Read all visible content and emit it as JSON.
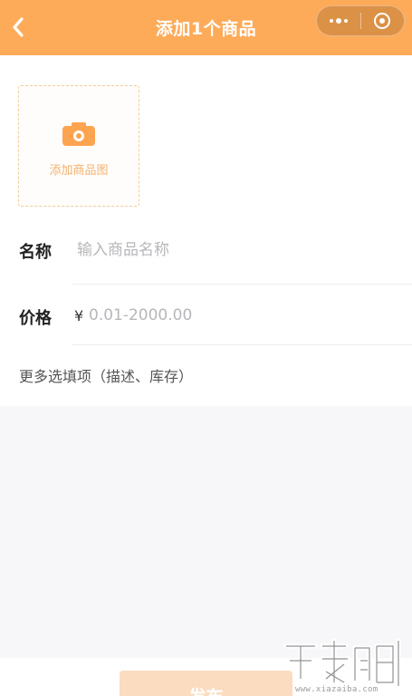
{
  "header": {
    "title": "添加1个商品",
    "back_icon": "chevron-left-icon",
    "menu_icon": "more-dots-icon",
    "close_icon": "circle-target-icon",
    "background_color": "#fdab59"
  },
  "image_upload": {
    "label": "添加商品图",
    "icon": "camera-icon",
    "accent_color": "#fda450"
  },
  "fields": {
    "name": {
      "label": "名称",
      "placeholder": "输入商品名称",
      "value": ""
    },
    "price": {
      "label": "价格",
      "currency_symbol": "¥",
      "placeholder": "0.01-2000.00",
      "value": ""
    }
  },
  "more_options": {
    "label": "更多选填项（描述、库存）"
  },
  "actions": {
    "publish_label": "发布",
    "publish_color": "#fbdcc0"
  },
  "watermark": {
    "site": "www.xiazaiba.com"
  }
}
